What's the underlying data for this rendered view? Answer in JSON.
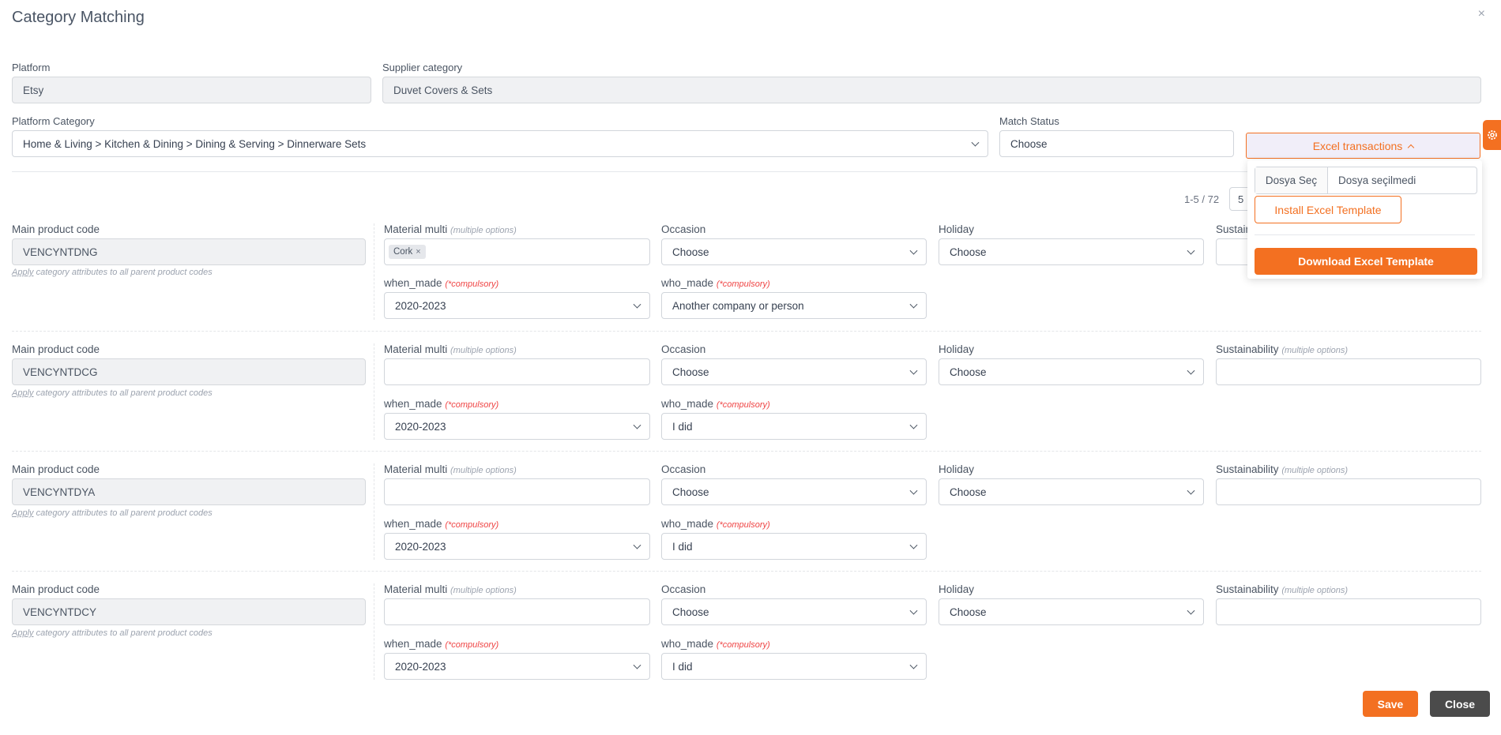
{
  "title": "Category Matching",
  "close_icon": "×",
  "platform": {
    "label": "Platform",
    "value": "Etsy"
  },
  "supplier_category": {
    "label": "Supplier category",
    "value": "Duvet Covers & Sets"
  },
  "platform_category": {
    "label": "Platform Category",
    "value": "Home & Living > Kitchen & Dining > Dining & Serving > Dinnerware Sets"
  },
  "match_status": {
    "label": "Match Status",
    "value": "Choose"
  },
  "excel": {
    "button_label": "Excel transactions",
    "file_button": "Dosya Seç",
    "file_name": "Dosya seçilmedi",
    "install_label": "Install Excel Template",
    "download_label": "Download Excel Template"
  },
  "pager": {
    "range": "1-5 / 72",
    "per_page": "5"
  },
  "labels": {
    "main_code": "Main product code",
    "apply_link": "Apply",
    "apply_text": " category attributes to all parent product codes",
    "material": "Material multi",
    "multiple": "(multiple options)",
    "occasion": "Occasion",
    "holiday": "Holiday",
    "sustainability": "Sustainability",
    "when_made": "when_made",
    "who_made": "who_made",
    "compulsory": "(*compulsory)"
  },
  "rows": [
    {
      "code": "VENCYNTDNG",
      "material_chip": "Cork",
      "occasion": "Choose",
      "holiday": "Choose",
      "when_made": "2020-2023",
      "who_made": "Another company or person"
    },
    {
      "code": "VENCYNTDCG",
      "occasion": "Choose",
      "holiday": "Choose",
      "when_made": "2020-2023",
      "who_made": "I did"
    },
    {
      "code": "VENCYNTDYA",
      "occasion": "Choose",
      "holiday": "Choose",
      "when_made": "2020-2023",
      "who_made": "I did"
    },
    {
      "code": "VENCYNTDCY",
      "occasion": "Choose",
      "holiday": "Choose",
      "when_made": "2020-2023",
      "who_made": "I did"
    }
  ],
  "actions": {
    "save": "Save",
    "close": "Close"
  },
  "colors": {
    "accent": "#f37021",
    "dark_button": "#4b4b4b"
  }
}
